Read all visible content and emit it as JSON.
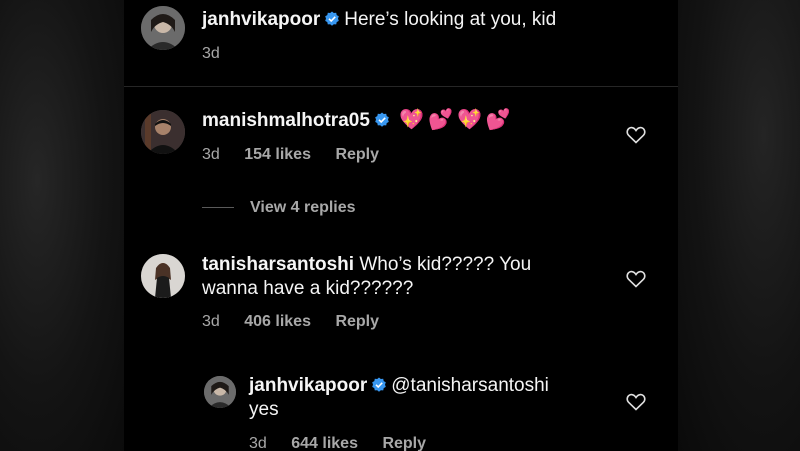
{
  "comments": [
    {
      "username": "janhvikapoor",
      "text": "Here’s looking at you, kid",
      "time": "3d"
    },
    {
      "username": "manishmalhotra05",
      "emojis": [
        "💖",
        "💕",
        "💖",
        "💕"
      ],
      "time": "3d",
      "likes": "154 likes",
      "reply_label": "Reply"
    },
    {
      "username": "tanisharsantoshi",
      "text_line1": "Who’s kid????? You",
      "text_line2": "wanna have a kid??????",
      "time": "3d",
      "likes": "406 likes",
      "reply_label": "Reply"
    }
  ],
  "view_replies": "View 4 replies",
  "reply": {
    "username": "janhvikapoor",
    "mention": "@tanisharsantoshi",
    "text": "yes",
    "time": "3d",
    "likes": "644 likes",
    "reply_label": "Reply"
  },
  "icons": {
    "verified": "verified-badge-icon",
    "like": "heart-outline-icon"
  },
  "colors": {
    "verified_blue": "#3897f0",
    "muted_text": "#a8a8a8"
  }
}
